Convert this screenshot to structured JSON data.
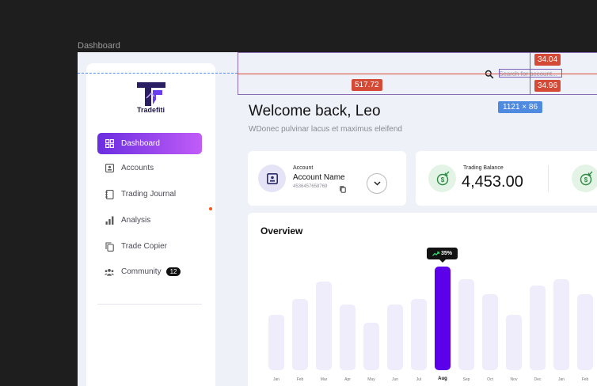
{
  "frame_label": "Dashboard",
  "brand": "Tradefiti",
  "sidebar": {
    "items": [
      {
        "label": "Dashboard",
        "icon": "grid-icon",
        "active": true
      },
      {
        "label": "Accounts",
        "icon": "id-card-icon"
      },
      {
        "label": "Trading Journal",
        "icon": "notebook-icon"
      },
      {
        "label": "Analysis",
        "icon": "bar-chart-icon"
      },
      {
        "label": "Trade Copier",
        "icon": "copy-icon"
      },
      {
        "label": "Community",
        "icon": "people-icon",
        "badge": "12"
      }
    ]
  },
  "header": {
    "welcome": "Welcome back, Leo",
    "subtitle": "WDonec pulvinar lacus et maximus eleifend",
    "search_placeholder": "Search for account..."
  },
  "account_card": {
    "label": "Account",
    "name": "Account Name",
    "number": "4536457658769"
  },
  "balance_card": {
    "label": "Trading Balance",
    "value": "4,453.00"
  },
  "overview": {
    "title": "Overview",
    "tooltip": "35%"
  },
  "chart_data": {
    "type": "bar",
    "categories": [
      "Jan",
      "Feb",
      "Mar",
      "Apr",
      "May",
      "Jun",
      "Jul",
      "Aug",
      "Sep",
      "Oct",
      "Nov",
      "Dec",
      "Jan",
      "Feb"
    ],
    "values": [
      70,
      90,
      112,
      83,
      60,
      83,
      90,
      131,
      115,
      96,
      70,
      107,
      115,
      96
    ],
    "highlight_index": 7,
    "highlight_color": "#5d00ea",
    "bar_color": "#efedfb",
    "ylim": [
      0,
      140
    ],
    "grid": false
  },
  "overlays": {
    "measure_left": "517.72",
    "measure_top": "34.04",
    "measure_bottom": "34.96",
    "dimensions": "1121 × 86"
  },
  "colors": {
    "accent_start": "#6a2ee0",
    "accent_end": "#c15cf8",
    "brand_dark": "#1b1446"
  }
}
